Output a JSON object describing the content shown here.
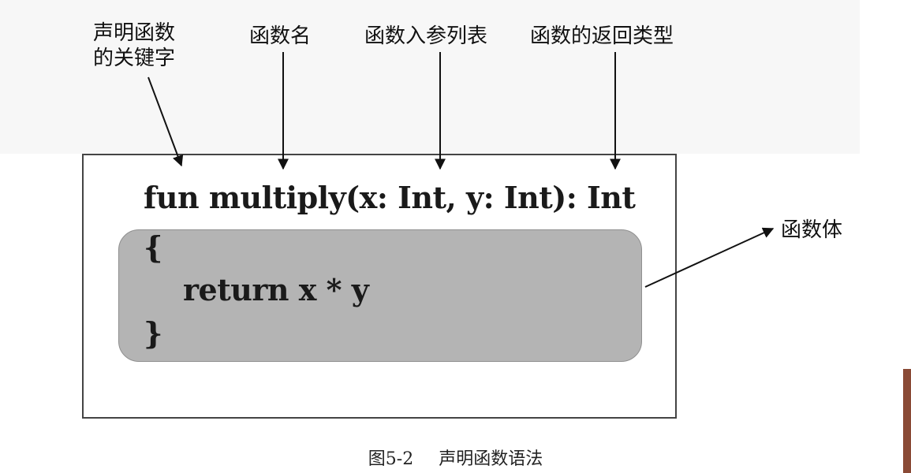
{
  "diagram": {
    "labels": {
      "keyword": "声明函数\n的关键字",
      "name": "函数名",
      "params": "函数入参列表",
      "return_type": "函数的返回类型",
      "body": "函数体"
    },
    "code": {
      "signature": "fun multiply(x: Int, y: Int): Int",
      "open_brace": "{",
      "return_line": "return x * y",
      "close_brace": "}"
    },
    "colors": {
      "body_fill": "#b4b4b4",
      "frame_stroke": "#444444"
    }
  },
  "caption": {
    "number": "图5-2",
    "title": "声明函数语法"
  }
}
